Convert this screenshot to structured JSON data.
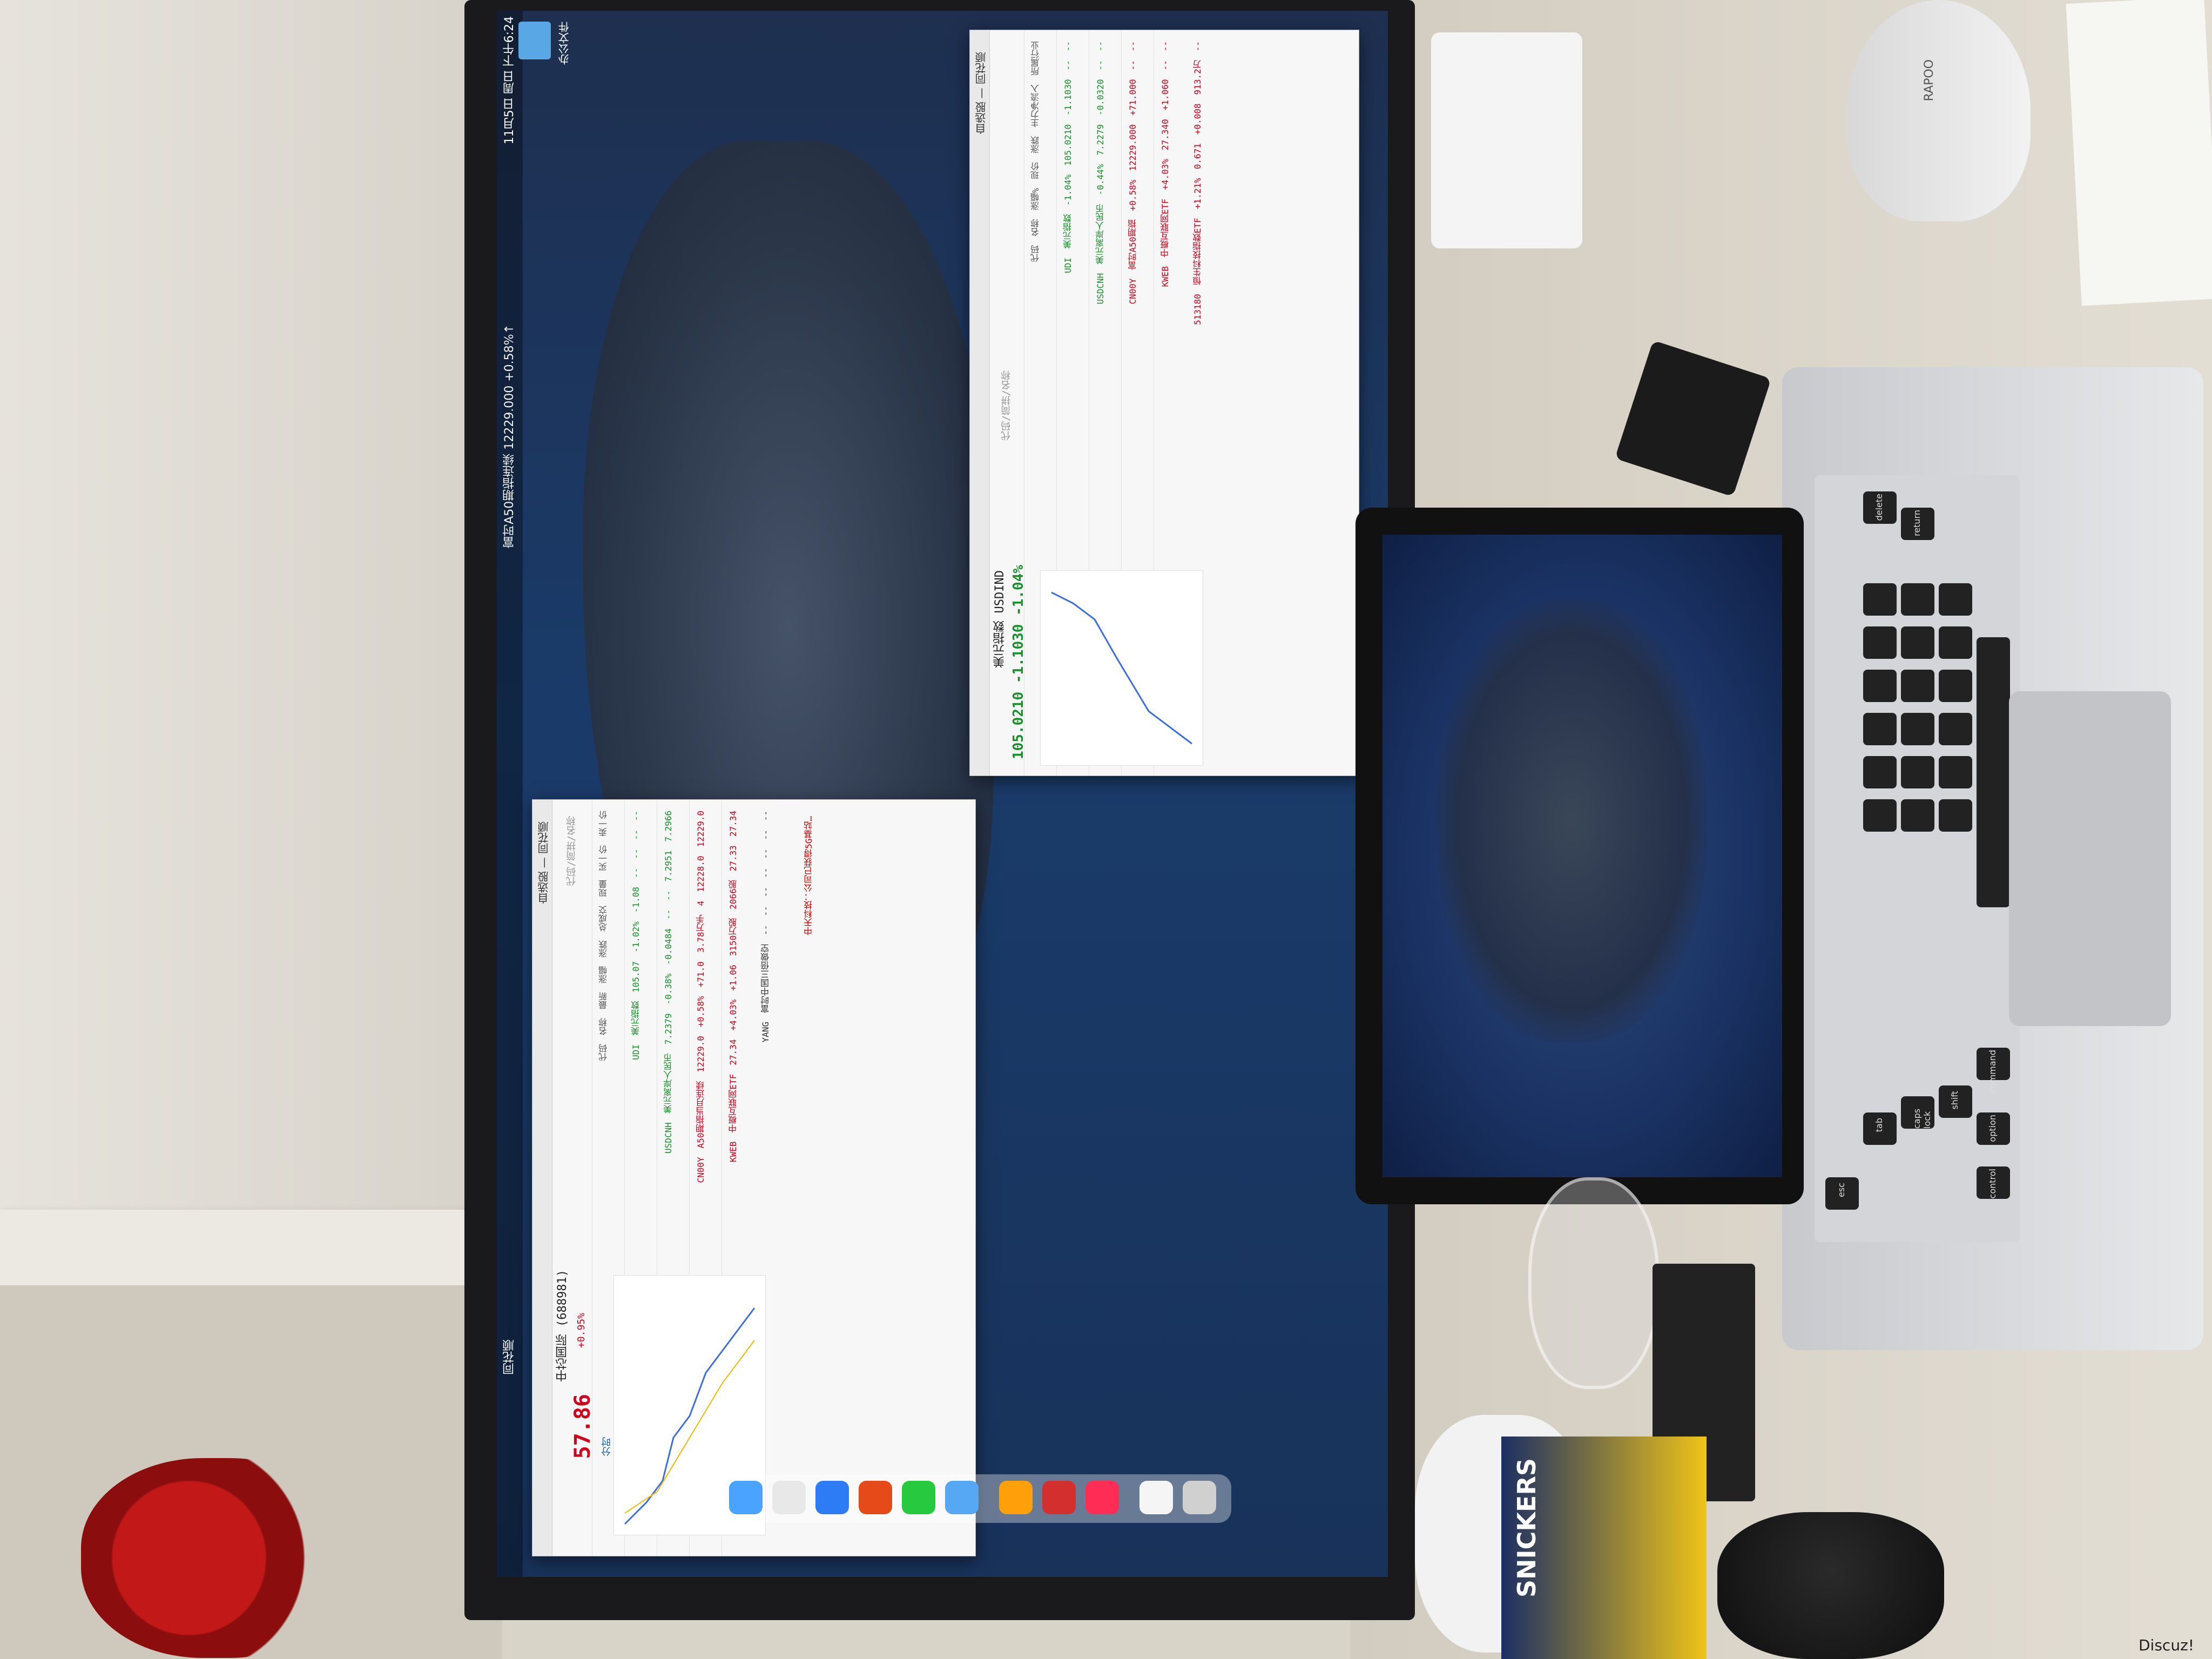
{
  "menubar": {
    "app_name": "同花顺",
    "clock": "11月5日 周日 下午6:24",
    "ticker": "富时A50期指连续 12229.000 +0.58%↑"
  },
  "desktop": {
    "folder_label": "办公文件"
  },
  "left_window": {
    "title": "自选股 — 同花顺",
    "search_placeholder": "代码/简拼/名称",
    "headers": [
      "代码",
      "名称",
      "最新",
      "涨幅",
      "涨跌",
      "总成交",
      "现量",
      "买一价",
      "卖一价"
    ],
    "rows": [
      [
        "UDI",
        "美元指数",
        "105.07",
        "-1.02%",
        "-1.08",
        "--",
        "--",
        "--",
        "--"
      ],
      [
        "USDCNH",
        "美元离岸人民币",
        "7.2379",
        "-0.38%",
        "-0.0484",
        "--",
        "--",
        "7.2951",
        "7.2966"
      ],
      [
        "CN00Y",
        "A50期指当月连续",
        "12229.0",
        "+0.58%",
        "+71.0",
        "3.78万手",
        "4",
        "12228.0",
        "12229.0"
      ],
      [
        "KWEB",
        "中概互联网ETF",
        "27.34",
        "+4.03%",
        "+1.06",
        "3150万股",
        "2066股",
        "27.33",
        "27.34"
      ],
      [
        "YANG",
        "富时中国三倍做空",
        "--",
        "--",
        "--",
        "--",
        "--",
        "--",
        "--"
      ]
    ],
    "quote": {
      "code": "688981",
      "name": "中芯国际",
      "price": "57.86",
      "change": "+0.95%",
      "tab": "分时"
    },
    "news": "中天科技：公司已获得5G基站…"
  },
  "right_window": {
    "title": "自选股 — 同花顺",
    "search_placeholder": "代码/简拼/名称",
    "headers": [
      "代码",
      "名称",
      "涨幅%",
      "现价",
      "涨跌",
      "主力净流入",
      "所属行业"
    ],
    "rows": [
      [
        "UDI",
        "美元指数",
        "-1.04%",
        "105.0210",
        "-1.1030",
        "--",
        "--"
      ],
      [
        "USDCNH",
        "美元离岸人民币",
        "-0.44%",
        "7.2279",
        "-0.0320",
        "--",
        "--"
      ],
      [
        "CN00Y",
        "富时A50期指",
        "+0.58%",
        "12229.000",
        "+71.000",
        "--",
        "--"
      ],
      [
        "KWEB",
        "中概互联网ETF",
        "+4.03%",
        "27.340",
        "+1.060",
        "--",
        "--"
      ],
      [
        "513180",
        "恒生科技指数ETF",
        "+1.21%",
        "0.671",
        "+0.008",
        "913.2万",
        "--"
      ]
    ],
    "quote": {
      "code": "USDIND",
      "name": "美元指数",
      "price": "105.0210",
      "change": "-1.1030",
      "change_pct": "-1.04%"
    }
  },
  "laptop": {
    "keys": [
      "esc",
      "tab",
      "caps lock",
      "shift",
      "control",
      "option",
      "command",
      "return",
      "delete"
    ]
  },
  "desk_items": {
    "mouse_brand": "RAPOO",
    "snack": "SNICKERS"
  },
  "watermark": "Discuz!"
}
